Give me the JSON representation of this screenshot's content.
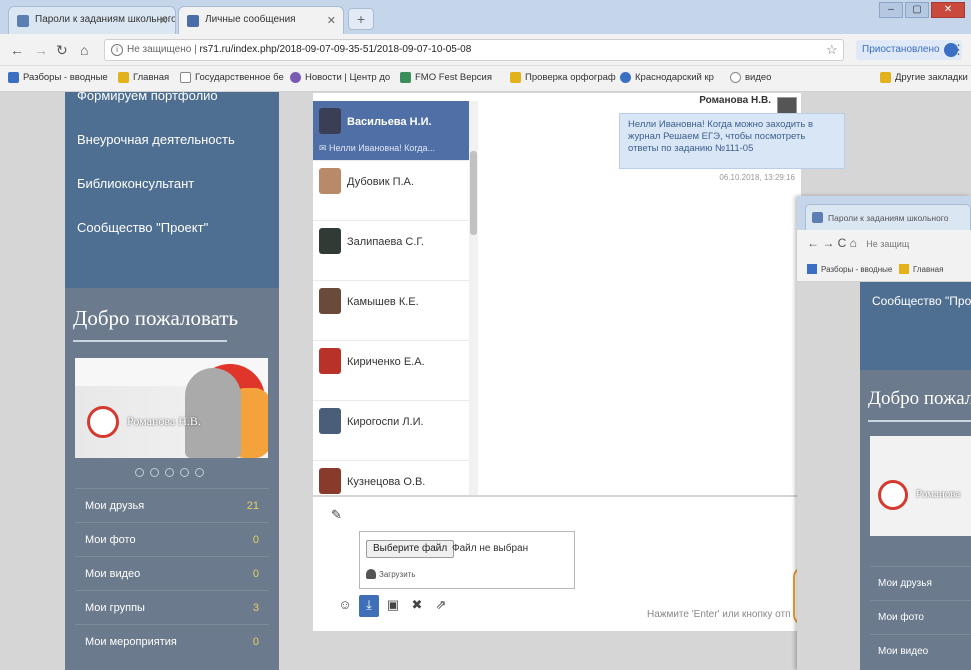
{
  "browser": {
    "tabs": [
      {
        "title": "Пароли к заданиям школьного"
      },
      {
        "title": "Личные сообщения"
      }
    ],
    "new_tab": "+",
    "url_security": "Не защищено",
    "url": "rs71.ru/index.php/2018-09-07-09-35-51/2018-09-07-10-05-08",
    "profile_label": "Приостановлено",
    "bookmarks": [
      "Разборы - вводные",
      "Главная",
      "Государственное бе",
      "Новости | Центр до",
      "FMO Fest Версия",
      "Проверка орфограф",
      "Краснодарский кр",
      "видео"
    ],
    "other_bookmarks": "Другие закладки"
  },
  "sidebar": {
    "menu": [
      "Формируем портфолио",
      "Внеурочная деятельность",
      "Библиоконсультант",
      "Сообщество \"Проект\""
    ],
    "welcome_title": "Добро пожаловать",
    "user_name": "Романова Н.В.",
    "stats": [
      {
        "label": "Мои друзья",
        "count": "21"
      },
      {
        "label": "Мои фото",
        "count": "0"
      },
      {
        "label": "Мои видео",
        "count": "0"
      },
      {
        "label": "Мои группы",
        "count": "3"
      },
      {
        "label": "Мои мероприятия",
        "count": "0"
      }
    ]
  },
  "contacts": [
    {
      "name": "Васильева Н.И.",
      "preview": "Нелли Ивановна! Когда...",
      "active": true,
      "color": "#3a3f55"
    },
    {
      "name": "Дубовик П.А.",
      "preview": "",
      "active": false,
      "color": "#b98a6a"
    },
    {
      "name": "Залипаева С.Г.",
      "preview": "",
      "active": false,
      "color": "#2f3b34"
    },
    {
      "name": "Камышев К.Е.",
      "preview": "",
      "active": false,
      "color": "#6a4a3a"
    },
    {
      "name": "Кириченко Е.А.",
      "preview": "",
      "active": false,
      "color": "#b8322a"
    },
    {
      "name": "Кирогоспи Л.И.",
      "preview": "",
      "active": false,
      "color": "#4a5e7a"
    },
    {
      "name": "Кузнецова О.В.",
      "preview": "",
      "active": false,
      "color": "#8a3a2a"
    }
  ],
  "chat": {
    "sender": "Романова Н.В.",
    "message": "Нелли Ивановна! Когда можно заходить в журнал Решаем ЕГЭ, чтобы посмотреть ответы по заданию №111-05",
    "timestamp": "06.10.2018, 13:29:16"
  },
  "composer": {
    "choose_file": "Выберите файл",
    "no_file": "Файл не выбран",
    "upload": "Загрузить",
    "hint": "Нажмите 'Enter' или кнопку отп"
  },
  "window2": {
    "tab": "Пароли к заданиям школьного",
    "addr_nav": "← → C ⌂",
    "addr_security": "Не защищ",
    "bookmark1": "Разборы - вводные",
    "bookmark2": "Главная",
    "menu_item": "Сообщество \"Проект\"",
    "welcome_title": "Добро пожаловать",
    "user_name": "Романова",
    "stats": [
      "Мои друзья",
      "Мои фото",
      "Мои видео"
    ]
  }
}
